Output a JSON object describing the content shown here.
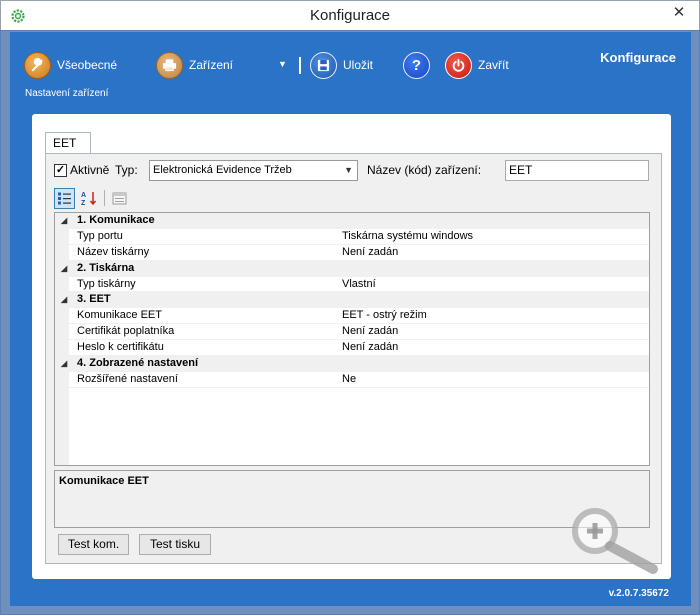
{
  "window": {
    "title": "Konfigurace",
    "close_glyph": "✕",
    "app_icon": "gear-icon"
  },
  "toolbar": {
    "general_label": "Všeobecné",
    "devices_label": "Zařízení",
    "save_label": "Uložit",
    "help_glyph": "?",
    "close_label": "Zavřít",
    "dropdown_glyph": "▼",
    "subtitle": "Nastavení zařízení",
    "brand": "Konfigurace"
  },
  "tab": {
    "label": "EET"
  },
  "form": {
    "active_checked_glyph": "✓",
    "active_label": "Aktivně",
    "type_label": "Typ:",
    "type_value": "Elektronická Evidence Tržeb",
    "name_label": "Název (kód) zařízení:",
    "name_value": "EET"
  },
  "grid": {
    "rows": [
      {
        "kind": "cat",
        "text": "1. Komunikace"
      },
      {
        "kind": "prop",
        "name": "Typ portu",
        "value": "Tiskárna systému windows"
      },
      {
        "kind": "prop",
        "name": "Název tiskárny",
        "value": "Není zadán"
      },
      {
        "kind": "cat",
        "text": "2. Tiskárna"
      },
      {
        "kind": "prop",
        "name": "Typ tiskárny",
        "value": "Vlastní"
      },
      {
        "kind": "cat",
        "text": "3. EET"
      },
      {
        "kind": "prop",
        "name": "Komunikace EET",
        "value": "EET - ostrý režim"
      },
      {
        "kind": "prop",
        "name": "Certifikát poplatníka",
        "value": "Není zadán"
      },
      {
        "kind": "prop",
        "name": "Heslo k certifikátu",
        "value": "Není zadán"
      },
      {
        "kind": "cat",
        "text": "4. Zobrazené nastavení"
      },
      {
        "kind": "prop",
        "name": "Rozšířené nastavení",
        "value": "Ne"
      }
    ],
    "toggle_glyph": "◢"
  },
  "description": {
    "title": "Komunikace EET"
  },
  "buttons": {
    "test_comm": "Test kom.",
    "test_print": "Test tisku"
  },
  "version": "v.2.0.7.35672",
  "colors": {
    "frame": "#6f8fbd",
    "client": "#2b73c7",
    "panel": "#ffffff"
  }
}
